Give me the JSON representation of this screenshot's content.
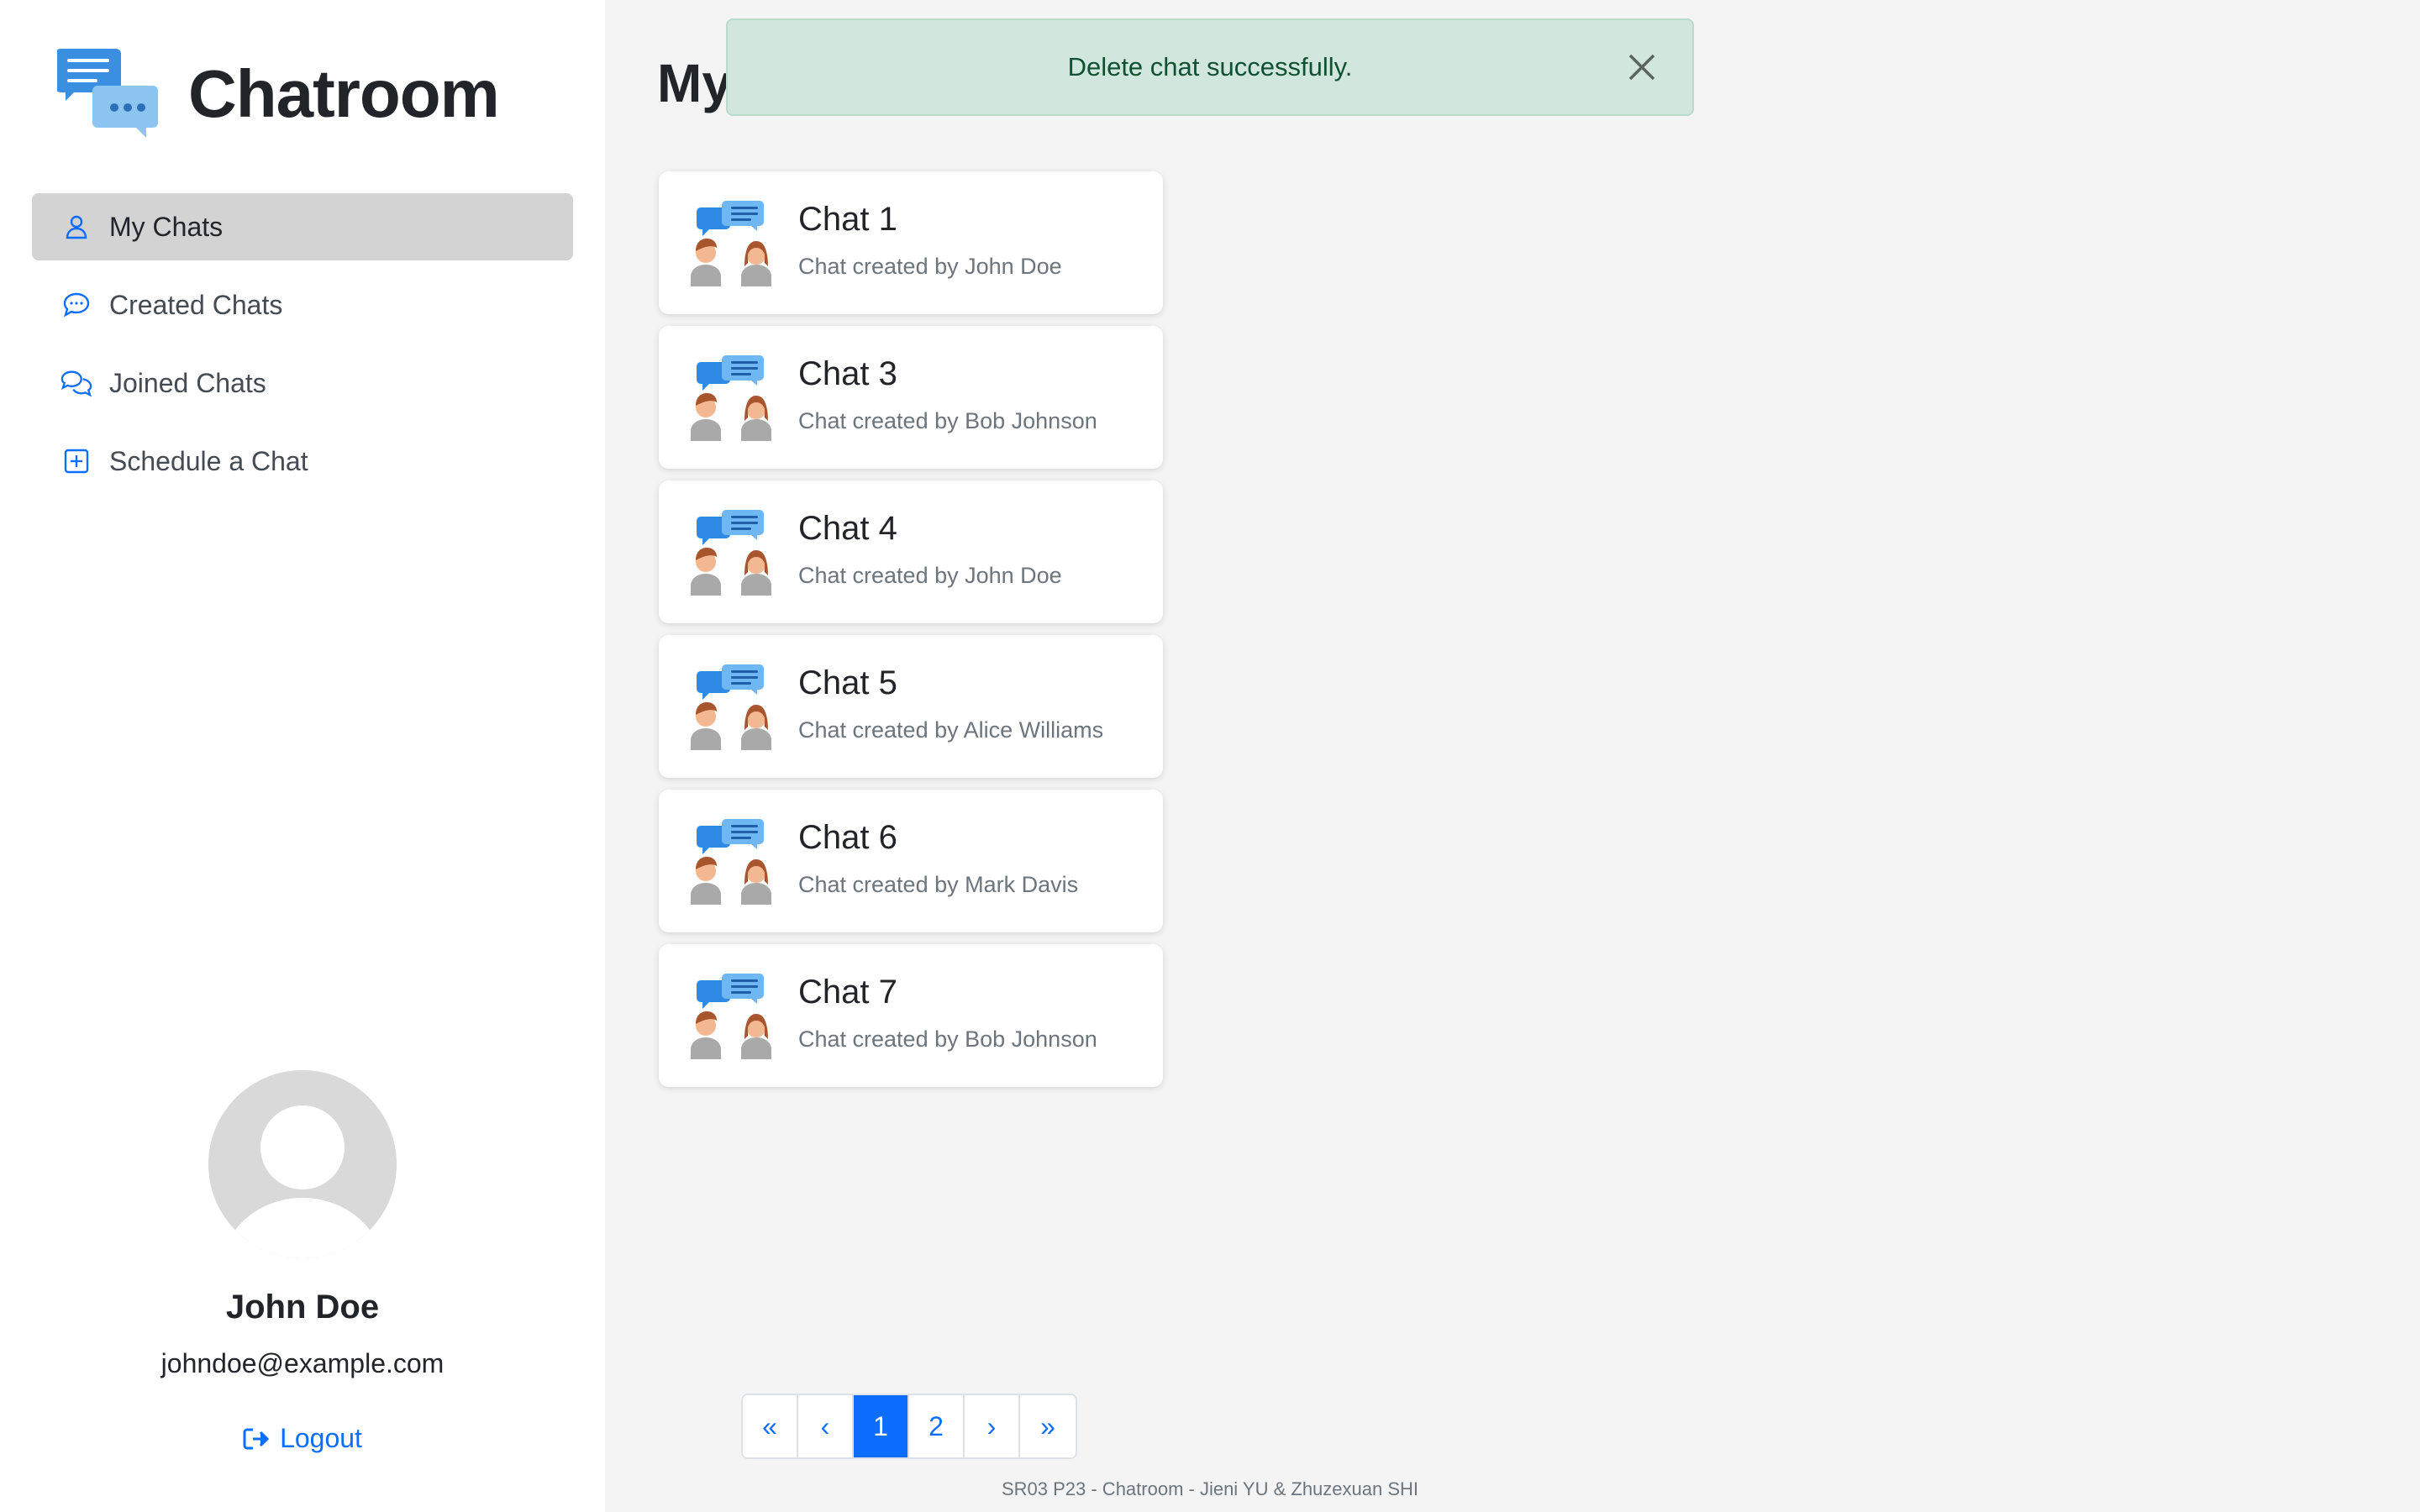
{
  "app": {
    "title": "Chatroom"
  },
  "sidebar": {
    "items": [
      {
        "label": "My Chats",
        "icon": "person-icon",
        "active": true
      },
      {
        "label": "Created Chats",
        "icon": "chat-dots-icon",
        "active": false
      },
      {
        "label": "Joined Chats",
        "icon": "chats-icon",
        "active": false
      },
      {
        "label": "Schedule a Chat",
        "icon": "plus-square-icon",
        "active": false
      }
    ]
  },
  "profile": {
    "name": "John Doe",
    "email": "johndoe@example.com",
    "logout_label": "Logout"
  },
  "main": {
    "heading": "My"
  },
  "alert": {
    "message": "Delete chat successfully."
  },
  "chats": [
    {
      "title": "Chat 1",
      "subtitle": "Chat created by John Doe"
    },
    {
      "title": "Chat 3",
      "subtitle": "Chat created by Bob Johnson"
    },
    {
      "title": "Chat 4",
      "subtitle": "Chat created by John Doe"
    },
    {
      "title": "Chat 5",
      "subtitle": "Chat created by Alice Williams"
    },
    {
      "title": "Chat 6",
      "subtitle": "Chat created by Mark Davis"
    },
    {
      "title": "Chat 7",
      "subtitle": "Chat created by Bob Johnson"
    }
  ],
  "pagination": {
    "first": "«",
    "prev": "‹",
    "pages": [
      "1",
      "2"
    ],
    "current": "1",
    "next": "›",
    "last": "»"
  },
  "footer": {
    "text": "SR03 P23 - Chatroom - Jieni YU & Zhuzexuan SHI"
  },
  "colors": {
    "accent": "#0d6efd",
    "alert_bg": "#d1e7dd",
    "alert_text": "#0f5132",
    "active_nav": "#d3d3d3",
    "background": "#f4f4f4"
  }
}
